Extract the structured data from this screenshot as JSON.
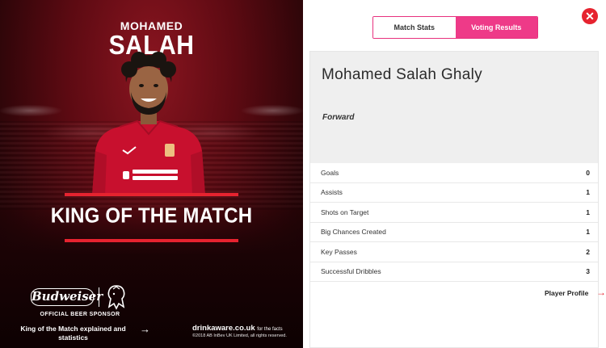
{
  "hero": {
    "first_name": "MOHAMED",
    "last_name": "SALAH",
    "title": "KING OF THE MATCH",
    "accent_color": "#e6232f"
  },
  "sponsor": {
    "brand": "Budweiser",
    "label": "OFFICIAL BEER SPONSOR"
  },
  "footer": {
    "explained_link": "King of the Match explained and statistics",
    "drinkaware_text": "drinkaware.co.uk",
    "drinkaware_suffix": "for the facts",
    "copyright": "©2018 AB InBev UK Limited, all rights reserved."
  },
  "tabs": [
    {
      "label": "Match Stats",
      "active": false
    },
    {
      "label": "Voting Results",
      "active": true
    }
  ],
  "close_icon": "close-icon",
  "player": {
    "full_name": "Mohamed Salah Ghaly",
    "position": "Forward"
  },
  "stats": [
    {
      "label": "Goals",
      "value": "0"
    },
    {
      "label": "Assists",
      "value": "1"
    },
    {
      "label": "Shots on Target",
      "value": "1"
    },
    {
      "label": "Big Chances Created",
      "value": "1"
    },
    {
      "label": "Key Passes",
      "value": "2"
    },
    {
      "label": "Successful Dribbles",
      "value": "3"
    }
  ],
  "profile_link": "Player Profile",
  "colors": {
    "tab_active": "#ee3a88",
    "tab_border": "#e8317e",
    "close_bg": "#e6232f"
  }
}
